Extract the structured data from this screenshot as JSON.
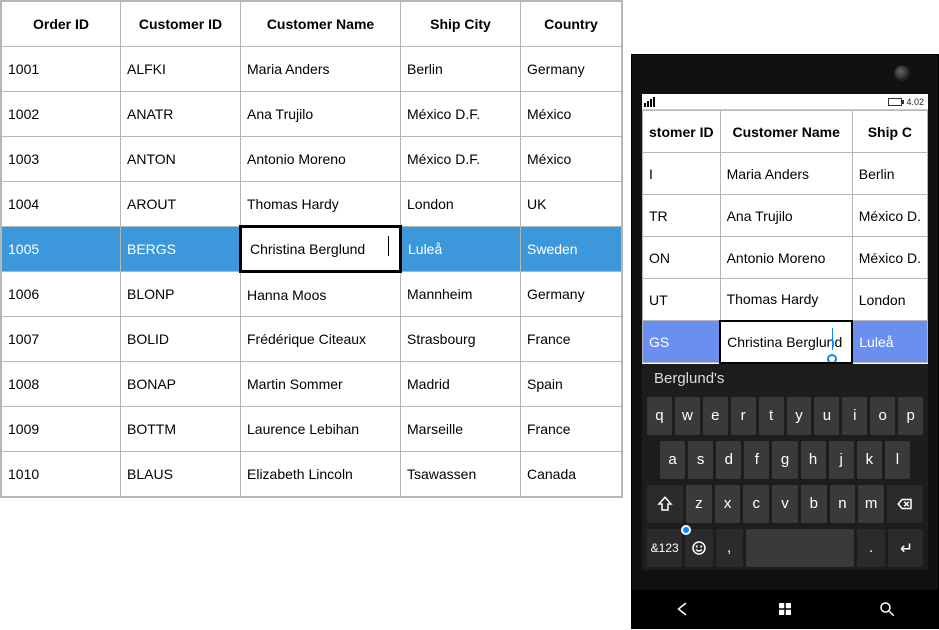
{
  "colors": {
    "selection_desktop": "#3c98db",
    "selection_mobile": "#6b8ff0",
    "accent": "#0a84ff"
  },
  "desktop": {
    "headers": {
      "order_id": "Order ID",
      "customer_id": "Customer ID",
      "customer_name": "Customer Name",
      "ship_city": "Ship City",
      "country": "Country"
    },
    "rows": [
      {
        "order_id": "1001",
        "customer_id": "ALFKI",
        "customer_name": "Maria Anders",
        "ship_city": "Berlin",
        "country": "Germany"
      },
      {
        "order_id": "1002",
        "customer_id": "ANATR",
        "customer_name": "Ana Trujilo",
        "ship_city": "México D.F.",
        "country": "México"
      },
      {
        "order_id": "1003",
        "customer_id": "ANTON",
        "customer_name": "Antonio Moreno",
        "ship_city": "México D.F.",
        "country": "México"
      },
      {
        "order_id": "1004",
        "customer_id": "AROUT",
        "customer_name": "Thomas Hardy",
        "ship_city": "London",
        "country": "UK"
      },
      {
        "order_id": "1005",
        "customer_id": "BERGS",
        "customer_name": "Christina Berglund",
        "ship_city": "Luleå",
        "country": "Sweden"
      },
      {
        "order_id": "1006",
        "customer_id": "BLONP",
        "customer_name": "Hanna Moos",
        "ship_city": "Mannheim",
        "country": "Germany"
      },
      {
        "order_id": "1007",
        "customer_id": "BOLID",
        "customer_name": "Frédérique Citeaux",
        "ship_city": "Strasbourg",
        "country": "France"
      },
      {
        "order_id": "1008",
        "customer_id": "BONAP",
        "customer_name": "Martin Sommer",
        "ship_city": "Madrid",
        "country": "Spain"
      },
      {
        "order_id": "1009",
        "customer_id": "BOTTM",
        "customer_name": "Laurence Lebihan",
        "ship_city": "Marseille",
        "country": "France"
      },
      {
        "order_id": "1010",
        "customer_id": "BLAUS",
        "customer_name": "Elizabeth Lincoln",
        "ship_city": "Tsawassen",
        "country": "Canada"
      }
    ],
    "selected_index": 4,
    "editing_column": "customer_name",
    "editing_value": "Christina Berglund"
  },
  "mobile": {
    "statusbar": {
      "time": "4.02"
    },
    "headers": {
      "customer_id": "stomer ID",
      "customer_name": "Customer Name",
      "ship_city": "Ship C"
    },
    "rows": [
      {
        "customer_id": "I",
        "customer_name": "Maria Anders",
        "ship_city": "Berlin"
      },
      {
        "customer_id": "TR",
        "customer_name": "Ana Trujilo",
        "ship_city": "México D."
      },
      {
        "customer_id": "ON",
        "customer_name": "Antonio Moreno",
        "ship_city": "México D."
      },
      {
        "customer_id": "UT",
        "customer_name": "Thomas Hardy",
        "ship_city": "London"
      },
      {
        "customer_id": "GS",
        "customer_name": "Christina Berglund",
        "ship_city": "Luleå"
      }
    ],
    "selected_index": 4,
    "editing_column": "customer_name",
    "editing_value": "Christina Berglund"
  },
  "keyboard": {
    "suggestion": "Berglund's",
    "row1": [
      "q",
      "w",
      "e",
      "r",
      "t",
      "y",
      "u",
      "i",
      "o",
      "p"
    ],
    "row2": [
      "a",
      "s",
      "d",
      "f",
      "g",
      "h",
      "j",
      "k",
      "l"
    ],
    "row3": [
      "z",
      "x",
      "c",
      "v",
      "b",
      "n",
      "m"
    ],
    "symbols_label": "&123",
    "comma": ",",
    "period": "."
  }
}
